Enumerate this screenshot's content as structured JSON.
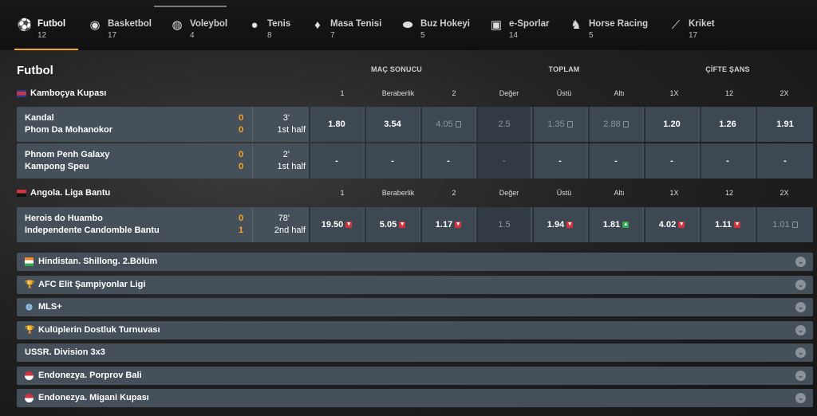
{
  "tabs": [
    {
      "label": "Futbol",
      "count": "12",
      "icon": "soccer-ball-icon",
      "active": true
    },
    {
      "label": "Basketbol",
      "count": "17",
      "icon": "basketball-icon"
    },
    {
      "label": "Voleybol",
      "count": "4",
      "icon": "volleyball-icon"
    },
    {
      "label": "Tenis",
      "count": "8",
      "icon": "tennis-ball-icon"
    },
    {
      "label": "Masa Tenisi",
      "count": "7",
      "icon": "table-tennis-icon"
    },
    {
      "label": "Buz Hokeyi",
      "count": "5",
      "icon": "hockey-puck-icon"
    },
    {
      "label": "e-Sporlar",
      "count": "14",
      "icon": "gamepad-icon"
    },
    {
      "label": "Horse Racing",
      "count": "5",
      "icon": "horse-icon"
    },
    {
      "label": "Kriket",
      "count": "17",
      "icon": "cricket-bat-icon"
    }
  ],
  "main": {
    "title": "Futbol",
    "groups": {
      "result": "MAÇ SONUCU",
      "total": "TOPLAM",
      "double": "ÇİFTE ŞANS"
    },
    "columns": [
      "1",
      "Beraberlik",
      "2",
      "Değer",
      "Üstü",
      "Altı",
      "1X",
      "12",
      "2X"
    ]
  },
  "leagues": [
    {
      "name": "Kamboçya Kupası",
      "matches": [
        {
          "home": "Kandal",
          "away": "Phom Da Mohanokor",
          "home_score": "0",
          "away_score": "0",
          "minute": "3'",
          "period": "1st half",
          "odds": [
            "1.80",
            "3.54",
            "4.05",
            "2.5",
            "1.35",
            "2.88",
            "1.20",
            "1.26",
            "1.91"
          ]
        },
        {
          "home": "Phnom Penh Galaxy",
          "away": "Kampong Speu",
          "home_score": "0",
          "away_score": "0",
          "minute": "2'",
          "period": "1st half",
          "odds": [
            "-",
            "-",
            "-",
            "-",
            "-",
            "-",
            "-",
            "-",
            "-"
          ]
        }
      ]
    },
    {
      "name": "Angola. Liga Bantu",
      "matches": [
        {
          "home": "Herois do Huambo",
          "away": "Independente Candomble Bantu",
          "home_score": "0",
          "away_score": "1",
          "minute": "78'",
          "period": "2nd half",
          "odds": [
            "19.50",
            "5.05",
            "1.17",
            "1.5",
            "1.94",
            "1.81",
            "4.02",
            "1.11",
            "1.01"
          ]
        }
      ]
    }
  ],
  "collapsed_leagues": [
    {
      "name": "Hindistan. Shillong. 2.Bölüm",
      "icon": "india-flag-icon"
    },
    {
      "name": "AFC Elit Şampiyonlar Ligi",
      "icon": "trophy-icon"
    },
    {
      "name": "MLS+",
      "icon": "globe-icon"
    },
    {
      "name": "Kulüplerin Dostluk Turnuvası",
      "icon": "trophy-icon"
    },
    {
      "name": "USSR. Division 3x3",
      "icon": ""
    },
    {
      "name": "Endonezya. Porprov Bali",
      "icon": "indonesia-flag-icon"
    },
    {
      "name": "Endonezya. Migani Kupası",
      "icon": "indonesia-flag-icon"
    }
  ],
  "colors": {
    "accent": "#f5a623",
    "row": "#46505b",
    "odds_cell": "#3e4852",
    "down": "#d0353f",
    "up": "#2fa84f"
  }
}
